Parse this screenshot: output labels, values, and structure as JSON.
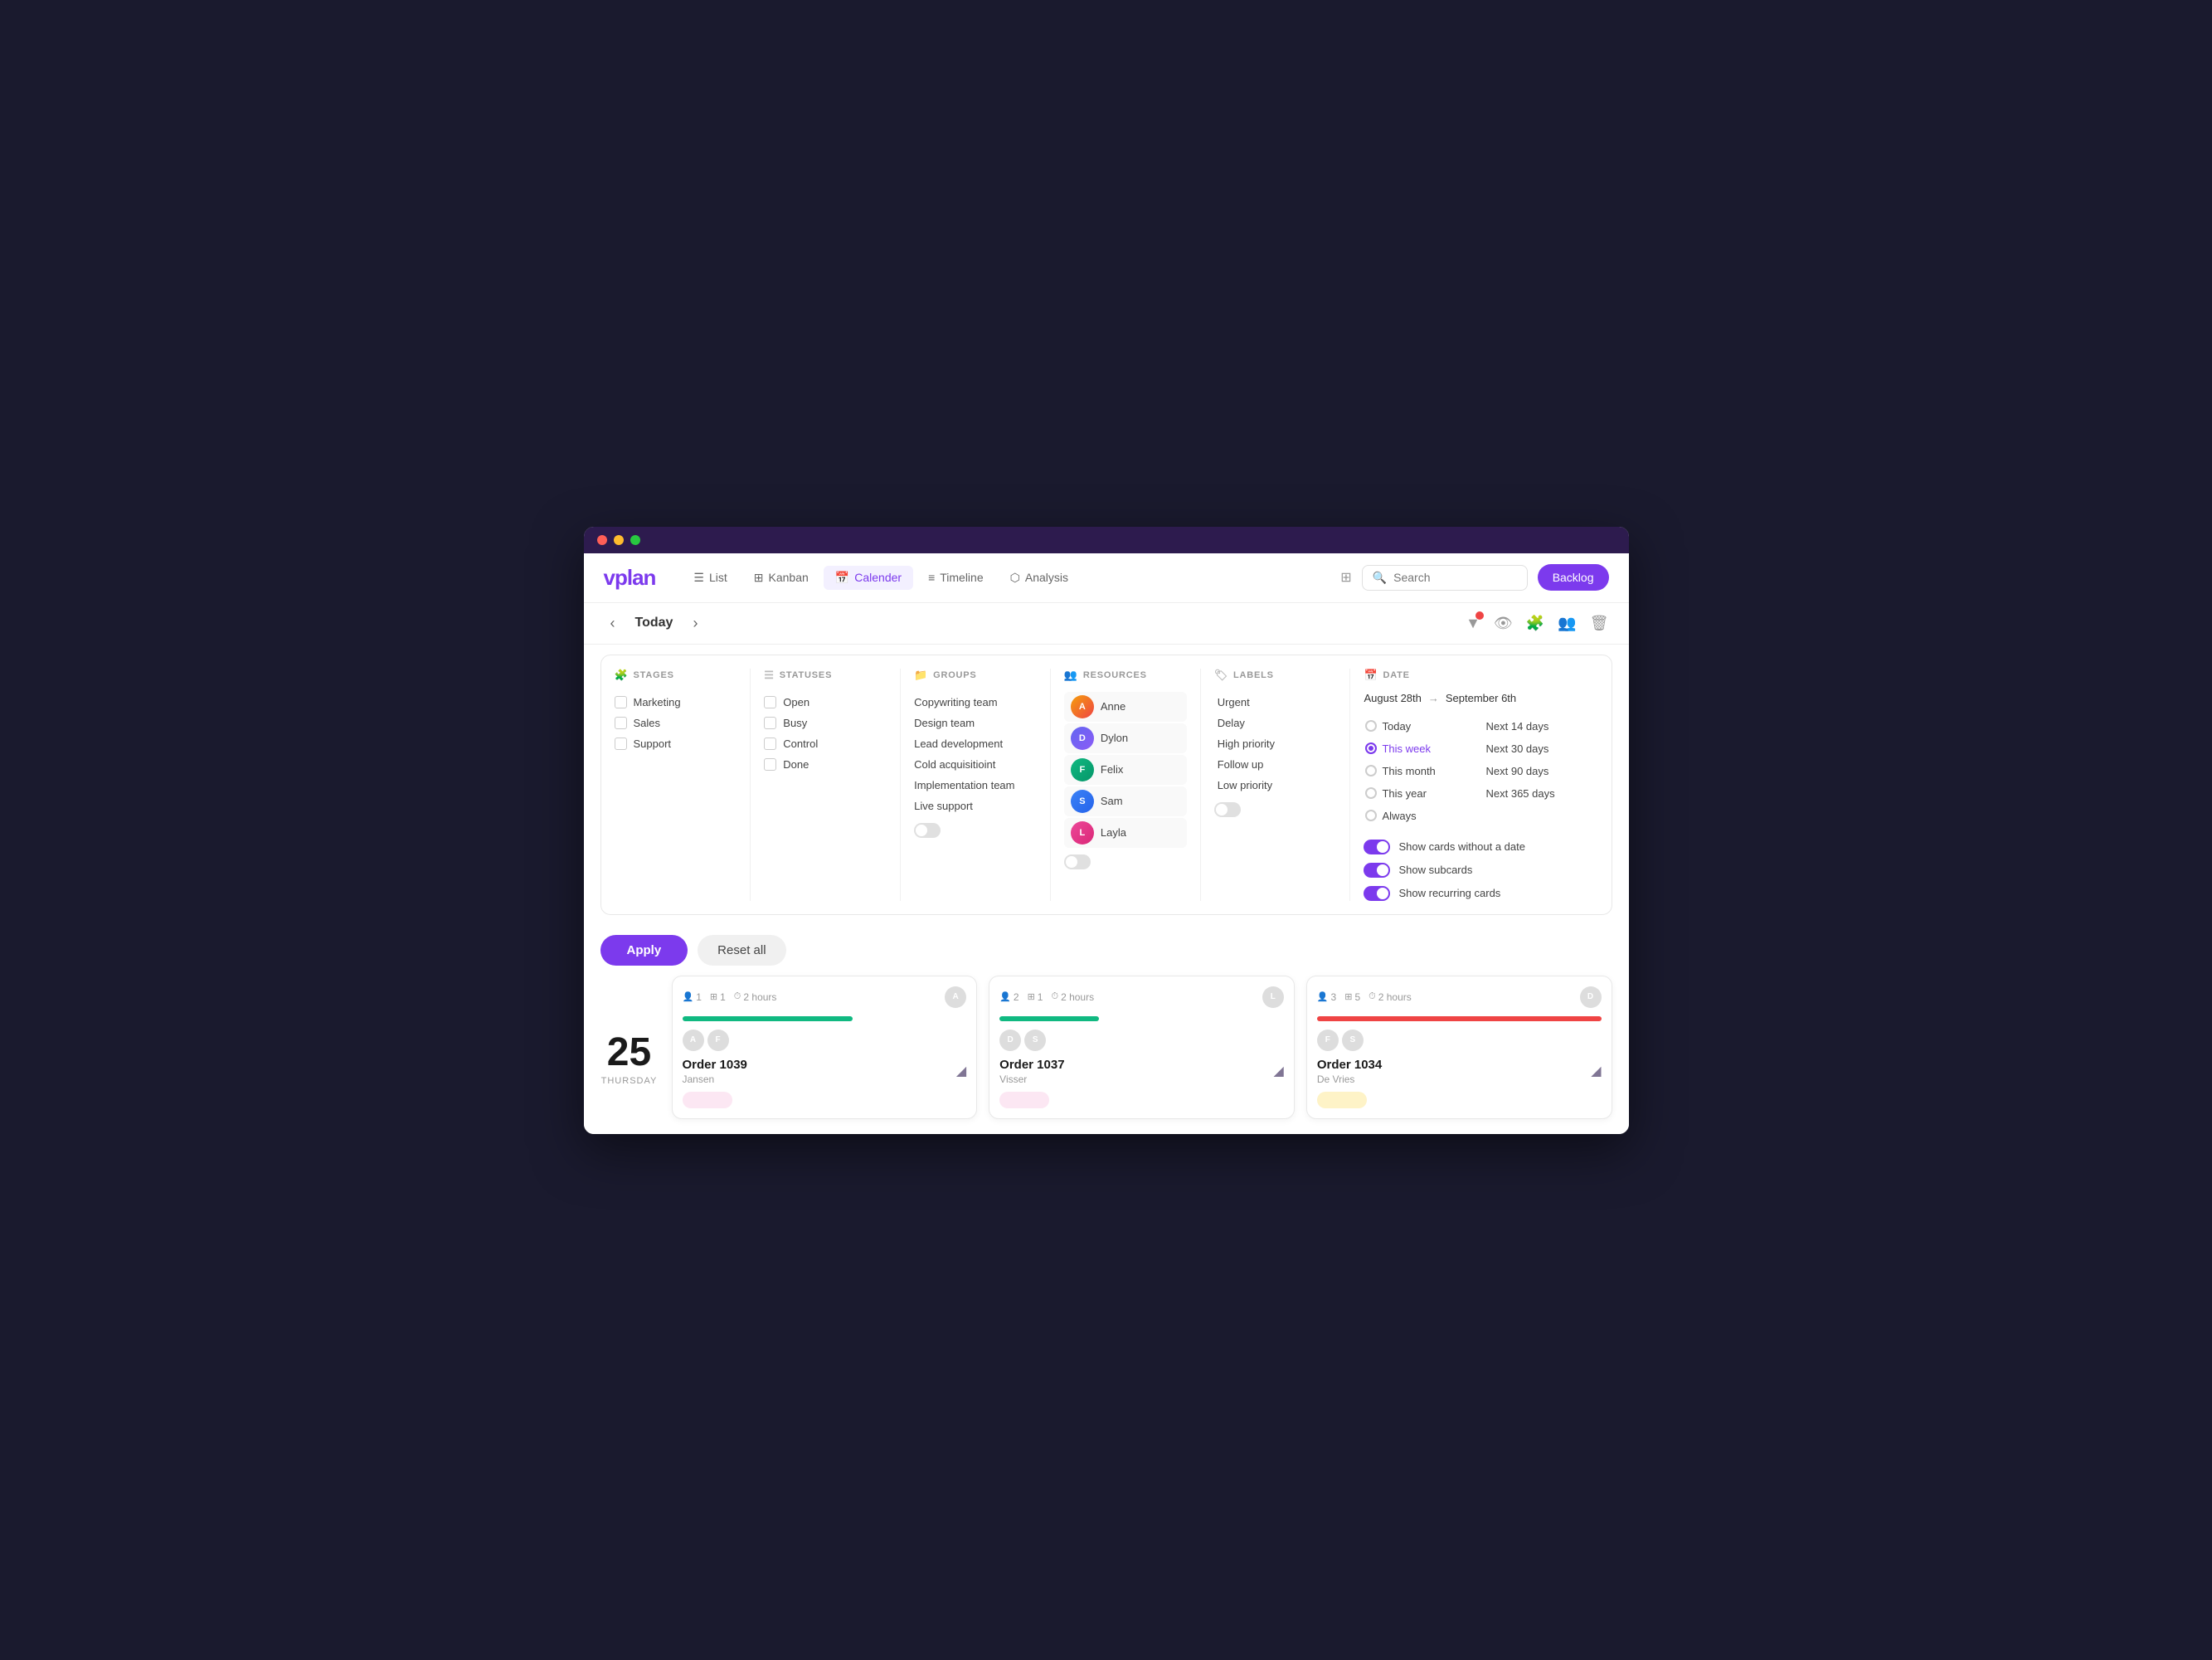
{
  "app": {
    "name": "vplan",
    "logo": "vplan"
  },
  "nav": {
    "tabs": [
      {
        "id": "list",
        "label": "List",
        "icon": "☰",
        "active": false
      },
      {
        "id": "kanban",
        "label": "Kanban",
        "icon": "⊞",
        "active": false
      },
      {
        "id": "calendar",
        "label": "Calender",
        "icon": "⊞",
        "active": true
      },
      {
        "id": "timeline",
        "label": "Timeline",
        "icon": "≡",
        "active": false
      },
      {
        "id": "analysis",
        "label": "Analysis",
        "icon": "⬡",
        "active": false
      }
    ],
    "backlog_label": "Backlog",
    "search_placeholder": "Search",
    "today_label": "Today"
  },
  "filter": {
    "stages": {
      "title": "STAGES",
      "items": [
        "Marketing",
        "Sales",
        "Support"
      ]
    },
    "statuses": {
      "title": "STATUSES",
      "items": [
        "Open",
        "Busy",
        "Control",
        "Done"
      ]
    },
    "groups": {
      "title": "GROUPS",
      "items": [
        "Copywriting team",
        "Design team",
        "Lead development",
        "Cold acquisitioint",
        "Implementation team",
        "Live support"
      ]
    },
    "resources": {
      "title": "RESOURCES",
      "items": [
        {
          "name": "Anne",
          "color": "anne"
        },
        {
          "name": "Dylon",
          "color": "dylon"
        },
        {
          "name": "Felix",
          "color": "felix"
        },
        {
          "name": "Sam",
          "color": "sam"
        },
        {
          "name": "Layla",
          "color": "layla"
        }
      ]
    },
    "labels": {
      "title": "LABELS",
      "items": [
        "Urgent",
        "Delay",
        "High priority",
        "Follow up",
        "Low priority"
      ]
    },
    "date": {
      "title": "DATE",
      "from": "August 28th",
      "to": "September 6th",
      "options_left": [
        "Today",
        "This week",
        "This month",
        "This year",
        "Always"
      ],
      "options_right": [
        "Next 14 days",
        "Next 30 days",
        "Next 90 days",
        "Next 365 days"
      ],
      "active_option": "This week",
      "toggles": [
        {
          "label": "Show cards without a date",
          "active": true
        },
        {
          "label": "Show subcards",
          "active": true
        },
        {
          "label": "Show recurring cards",
          "active": true
        }
      ]
    }
  },
  "actions": {
    "apply_label": "Apply",
    "reset_label": "Reset all"
  },
  "calendar": {
    "day_number": "25",
    "day_name": "THURSDAY",
    "cards": [
      {
        "order": "Order 1039",
        "subtitle": "Jansen",
        "members": 1,
        "subtasks": 1,
        "hours": "2 hours",
        "progress": 60,
        "progress_color": "green",
        "status_color": "pink"
      },
      {
        "order": "Order 1037",
        "subtitle": "Visser",
        "members": 2,
        "subtasks": 1,
        "hours": "2 hours",
        "progress": 35,
        "progress_color": "green",
        "status_color": "pink"
      },
      {
        "order": "Order 1034",
        "subtitle": "De Vries",
        "members": 3,
        "subtasks": 5,
        "hours": "2 hours",
        "progress": 100,
        "progress_color": "red",
        "status_color": "yellow"
      }
    ]
  }
}
